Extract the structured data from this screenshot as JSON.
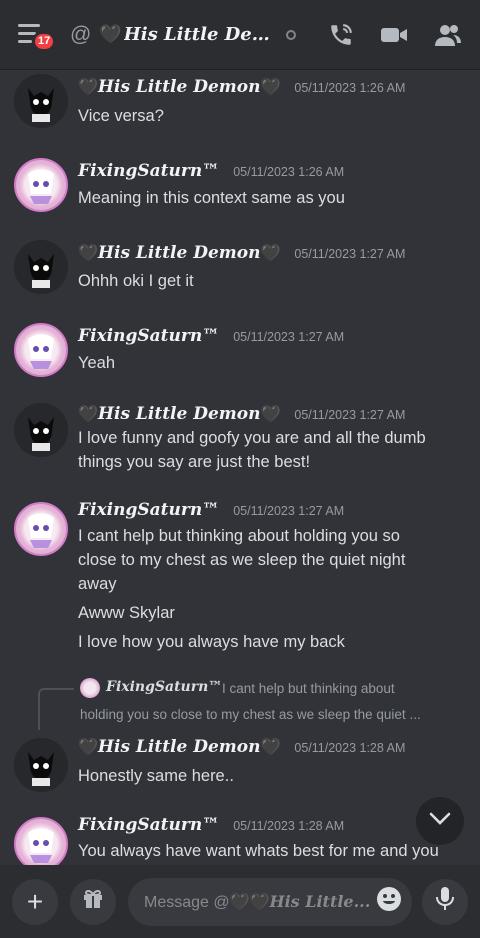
{
  "topbar": {
    "badge_count": "17",
    "at_sign": "@",
    "title_heart": "🖤",
    "channel_title": "His Little Dem...",
    "icons": [
      "menu-icon",
      "at-icon",
      "status-idle-icon",
      "call-icon",
      "video-icon",
      "members-icon"
    ]
  },
  "messages": [
    {
      "author": "His Little Demon",
      "heart_left": "🖤",
      "heart_right": "🖤",
      "timestamp": "05/11/2023 1:26 AM",
      "lines": [
        "Vice versa?"
      ]
    },
    {
      "author": "FixingSaturn™",
      "timestamp": "05/11/2023 1:26 AM",
      "lines": [
        "Meaning in this context same as you"
      ]
    },
    {
      "author": "His Little Demon",
      "heart_left": "🖤",
      "heart_right": "🖤",
      "timestamp": "05/11/2023 1:27 AM",
      "lines": [
        "Ohhh oki I get it"
      ]
    },
    {
      "author": "FixingSaturn™",
      "timestamp": "05/11/2023 1:27 AM",
      "lines": [
        "Yeah"
      ]
    },
    {
      "author": "His Little Demon",
      "heart_left": "🖤",
      "heart_right": "🖤",
      "timestamp": "05/11/2023 1:27 AM",
      "lines": [
        "I love funny and goofy you are and all the dumb",
        "things you say are just the best!"
      ]
    },
    {
      "author": "FixingSaturn™",
      "timestamp": "05/11/2023 1:27 AM",
      "lines": [
        "I cant help but thinking about holding you so",
        "close to my chest as we sleep the quiet night",
        "away"
      ],
      "extra": [
        "Awww Skylar",
        "I love how you always have my back"
      ]
    },
    {
      "author": "His Little Demon",
      "heart_left": "🖤",
      "heart_right": "🖤",
      "timestamp": "05/11/2023 1:28 AM",
      "lines": [
        "Honestly same here.."
      ]
    },
    {
      "author": "FixingSaturn™",
      "timestamp": "05/11/2023 1:28 AM",
      "lines": [
        "You always have want whats best for me and you"
      ]
    }
  ],
  "reply": {
    "author": "FixingSaturn™",
    "text_line1": "I cant help but thinking about",
    "text_line2": "holding you so close to my chest as we sleep the quiet ..."
  },
  "composer": {
    "placeholder_prefix": "Message @",
    "placeholder_hearts": "🖤🖤",
    "placeholder_name": "His Little...",
    "icons": [
      "plus-icon",
      "gift-icon",
      "emoji-icon",
      "microphone-icon"
    ]
  },
  "colors": {
    "background": "#313338",
    "topbar": "#2b2d31",
    "badge": "#f23f43",
    "timestamp": "#949ba4"
  }
}
